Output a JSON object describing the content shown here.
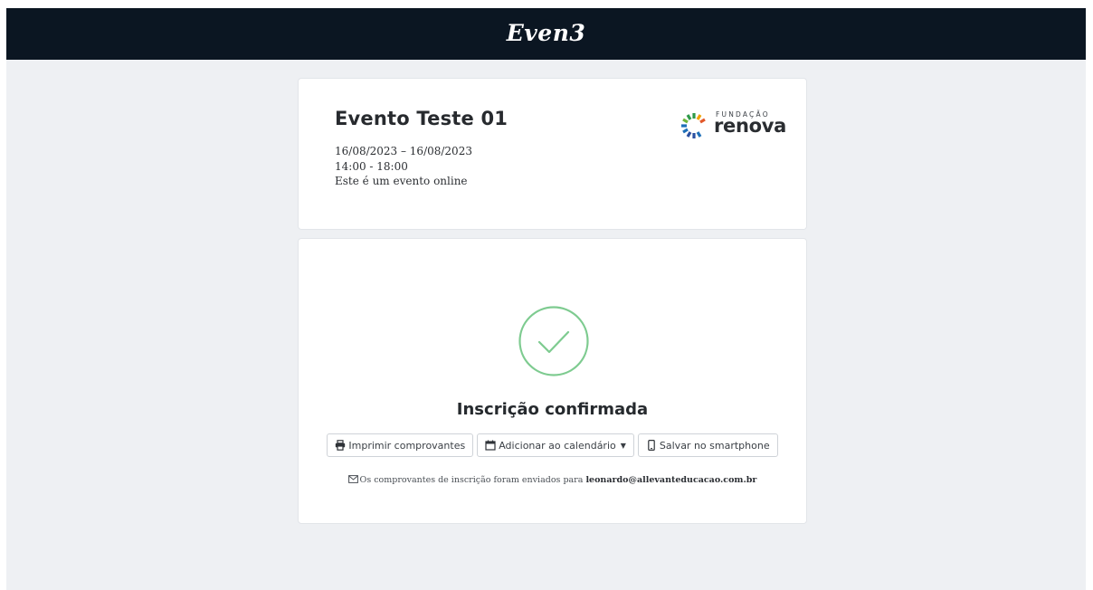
{
  "header": {
    "brand": "Even3"
  },
  "event": {
    "title": "Evento Teste 01",
    "dates": "16/08/2023 – 16/08/2023",
    "time": "14:00 - 18:00",
    "location": "Este é um evento online",
    "organizer_logo": {
      "small_text": "FUNDAÇÃO",
      "big_text": "renova",
      "colors": [
        "#2e9a48",
        "#f2a100",
        "#e2582a",
        "#1e6fb8"
      ]
    }
  },
  "confirmation": {
    "icon": "check-circle-icon",
    "icon_color": "#7ecb90",
    "title": "Inscrição confirmada",
    "buttons": {
      "print": "Imprimir comprovantes",
      "calendar": "Adicionar ao calendário",
      "smartphone": "Salvar no smartphone"
    },
    "note_prefix": "Os comprovantes de inscrição foram enviados para",
    "email": "leonardo@allevanteducacao.com.br"
  }
}
